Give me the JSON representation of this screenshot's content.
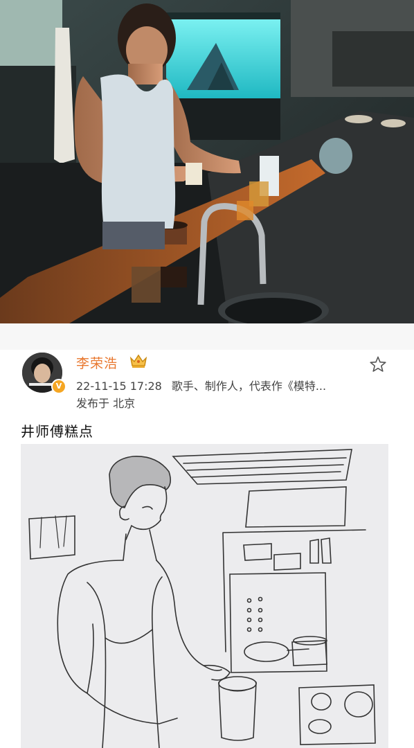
{
  "post": {
    "author": "李荣浩",
    "timestamp": "22-11-15 17:28",
    "bio": "歌手、制作人，代表作《模特...",
    "location": "发布于 北京",
    "caption": "井师傅糕点",
    "verified_badge": "V"
  },
  "icons": {
    "favorite": "star-outline-icon",
    "membership": "crown-icon"
  },
  "colors": {
    "username": "#e8772e",
    "verified": "#f5a623",
    "meta_text": "#444444"
  }
}
